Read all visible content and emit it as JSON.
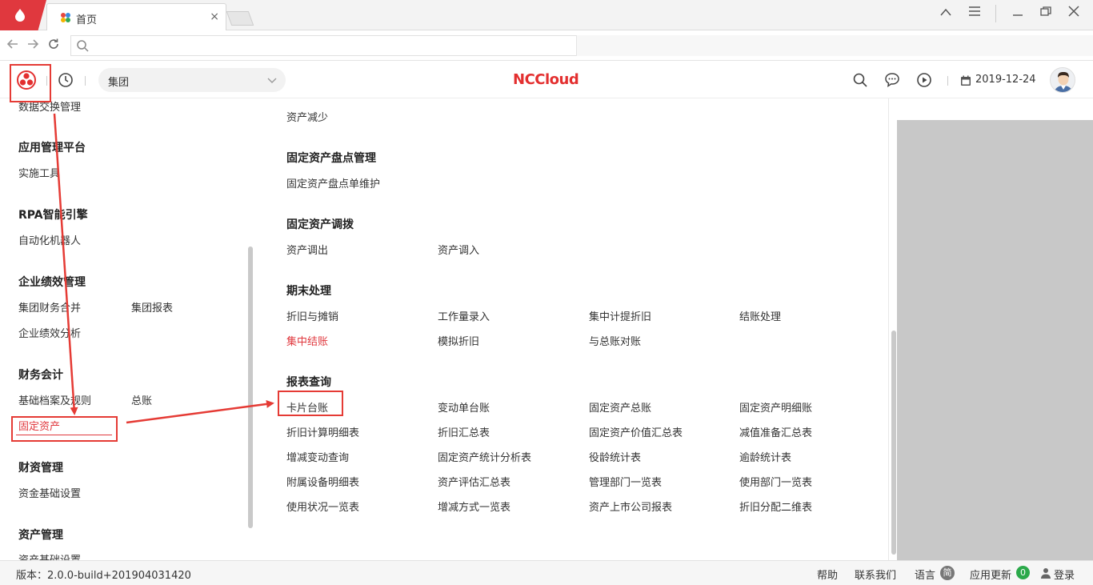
{
  "browser": {
    "tab_title": "首页",
    "tab_close": "×"
  },
  "header": {
    "group_select": "集团",
    "brand_nc": "NC",
    "brand_cloud": "Cloud",
    "date": "2019-12-24"
  },
  "left_menu": {
    "top_item": "数据交换管理",
    "sections": [
      {
        "title": "应用管理平台",
        "items": [
          "实施工具"
        ]
      },
      {
        "title": "RPA智能引擎",
        "items": [
          "自动化机器人"
        ]
      },
      {
        "title": "企业绩效管理",
        "items": [
          "集团财务合并",
          "集团报表",
          "企业绩效分析"
        ]
      },
      {
        "title": "财务会计",
        "items": [
          "基础档案及规则",
          "总账",
          "固定资产"
        ]
      },
      {
        "title": "财资管理",
        "items": [
          "资金基础设置"
        ]
      },
      {
        "title": "资产管理",
        "items": [
          "资产基础设置"
        ]
      }
    ],
    "active_item": "固定资产"
  },
  "right_panel": {
    "top_item": "资产减少",
    "groups": [
      {
        "title": "固定资产盘点管理",
        "items": [
          "固定资产盘点单维护"
        ]
      },
      {
        "title": "固定资产调拨",
        "items": [
          "资产调出",
          "资产调入"
        ]
      },
      {
        "title": "期末处理",
        "items": [
          "折旧与摊销",
          "工作量录入",
          "集中计提折旧",
          "结账处理",
          "集中结账",
          "模拟折旧",
          "与总账对账"
        ]
      },
      {
        "title": "报表查询",
        "items": [
          "卡片台账",
          "变动单台账",
          "固定资产总账",
          "固定资产明细账",
          "折旧计算明细表",
          "折旧汇总表",
          "固定资产价值汇总表",
          "减值准备汇总表",
          "增减变动查询",
          "固定资产统计分析表",
          "役龄统计表",
          "逾龄统计表",
          "附属设备明细表",
          "资产评估汇总表",
          "管理部门一览表",
          "使用部门一览表",
          "使用状况一览表",
          "增减方式一览表",
          "资产上市公司报表",
          "折旧分配二维表"
        ]
      }
    ]
  },
  "footer": {
    "version": "版本：2.0.0-build+201904031420",
    "help": "帮助",
    "contact": "联系我们",
    "language": "语言",
    "language_badge": "简",
    "update": "应用更新",
    "update_count": "0",
    "login": "登录"
  },
  "colors": {
    "accent_red": "#e0383e",
    "update_green": "#2ba94a"
  }
}
